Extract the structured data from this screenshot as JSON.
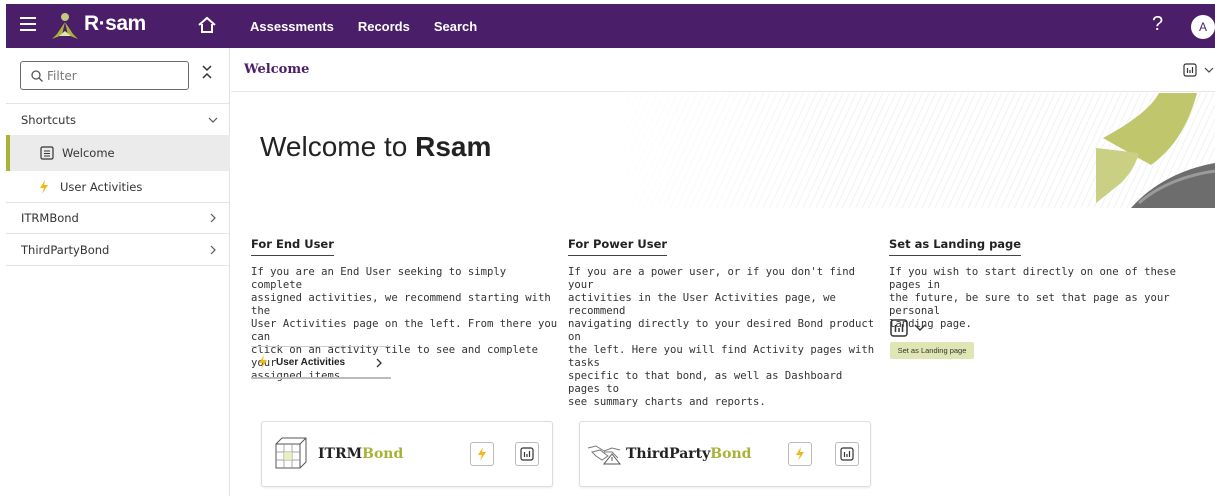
{
  "app": {
    "logo_text": "R·sam",
    "nav": [
      "Assessments",
      "Records",
      "Search"
    ],
    "help": "?",
    "avatar": "A",
    "brand_color": "#4b1e6a",
    "accent_color": "#a7b236"
  },
  "sidebar": {
    "filter_placeholder": "Filter",
    "items": [
      {
        "label": "Shortcuts",
        "icon": "chevron-down-icon"
      },
      {
        "label": "Welcome",
        "icon": "document-icon",
        "active": true
      },
      {
        "label": "User Activities",
        "icon": "bolt-icon"
      },
      {
        "label": "ITRMBond",
        "icon": "chevron-right-icon"
      },
      {
        "label": "ThirdPartyBond",
        "icon": "chevron-right-icon"
      }
    ]
  },
  "main": {
    "title": "Welcome",
    "welcome_prefix": "Welcome to ",
    "welcome_brand": "Rsam",
    "columns": [
      {
        "title": "For End User",
        "lines": [
          "If you are an End User seeking to simply complete",
          "assigned activities, we recommend starting with the",
          "User Activities page on the left. From there you can",
          "click on an activity tile to see and complete your",
          "assigned items."
        ]
      },
      {
        "title": "For Power User",
        "lines": [
          "If you are a power user, or if you don't find your",
          "activities in the User Activities page, we recommend",
          "navigating directly to your desired Bond product on",
          "the left. Here you will find Activity pages with tasks",
          "specific to that bond, as well as Dashboard pages to",
          "see summary charts and reports."
        ]
      },
      {
        "title": "Set as Landing page",
        "lines": [
          "If you wish to start directly on one of these pages in",
          "the future, be sure to set that page as your personal",
          "landing page."
        ]
      }
    ],
    "user_activities_link": "User Activities",
    "tooltip": "Set as Landing page",
    "cards": [
      {
        "prefix": "ITRM",
        "suffix": "Bond"
      },
      {
        "prefix": "ThirdParty",
        "suffix": "Bond"
      }
    ]
  }
}
